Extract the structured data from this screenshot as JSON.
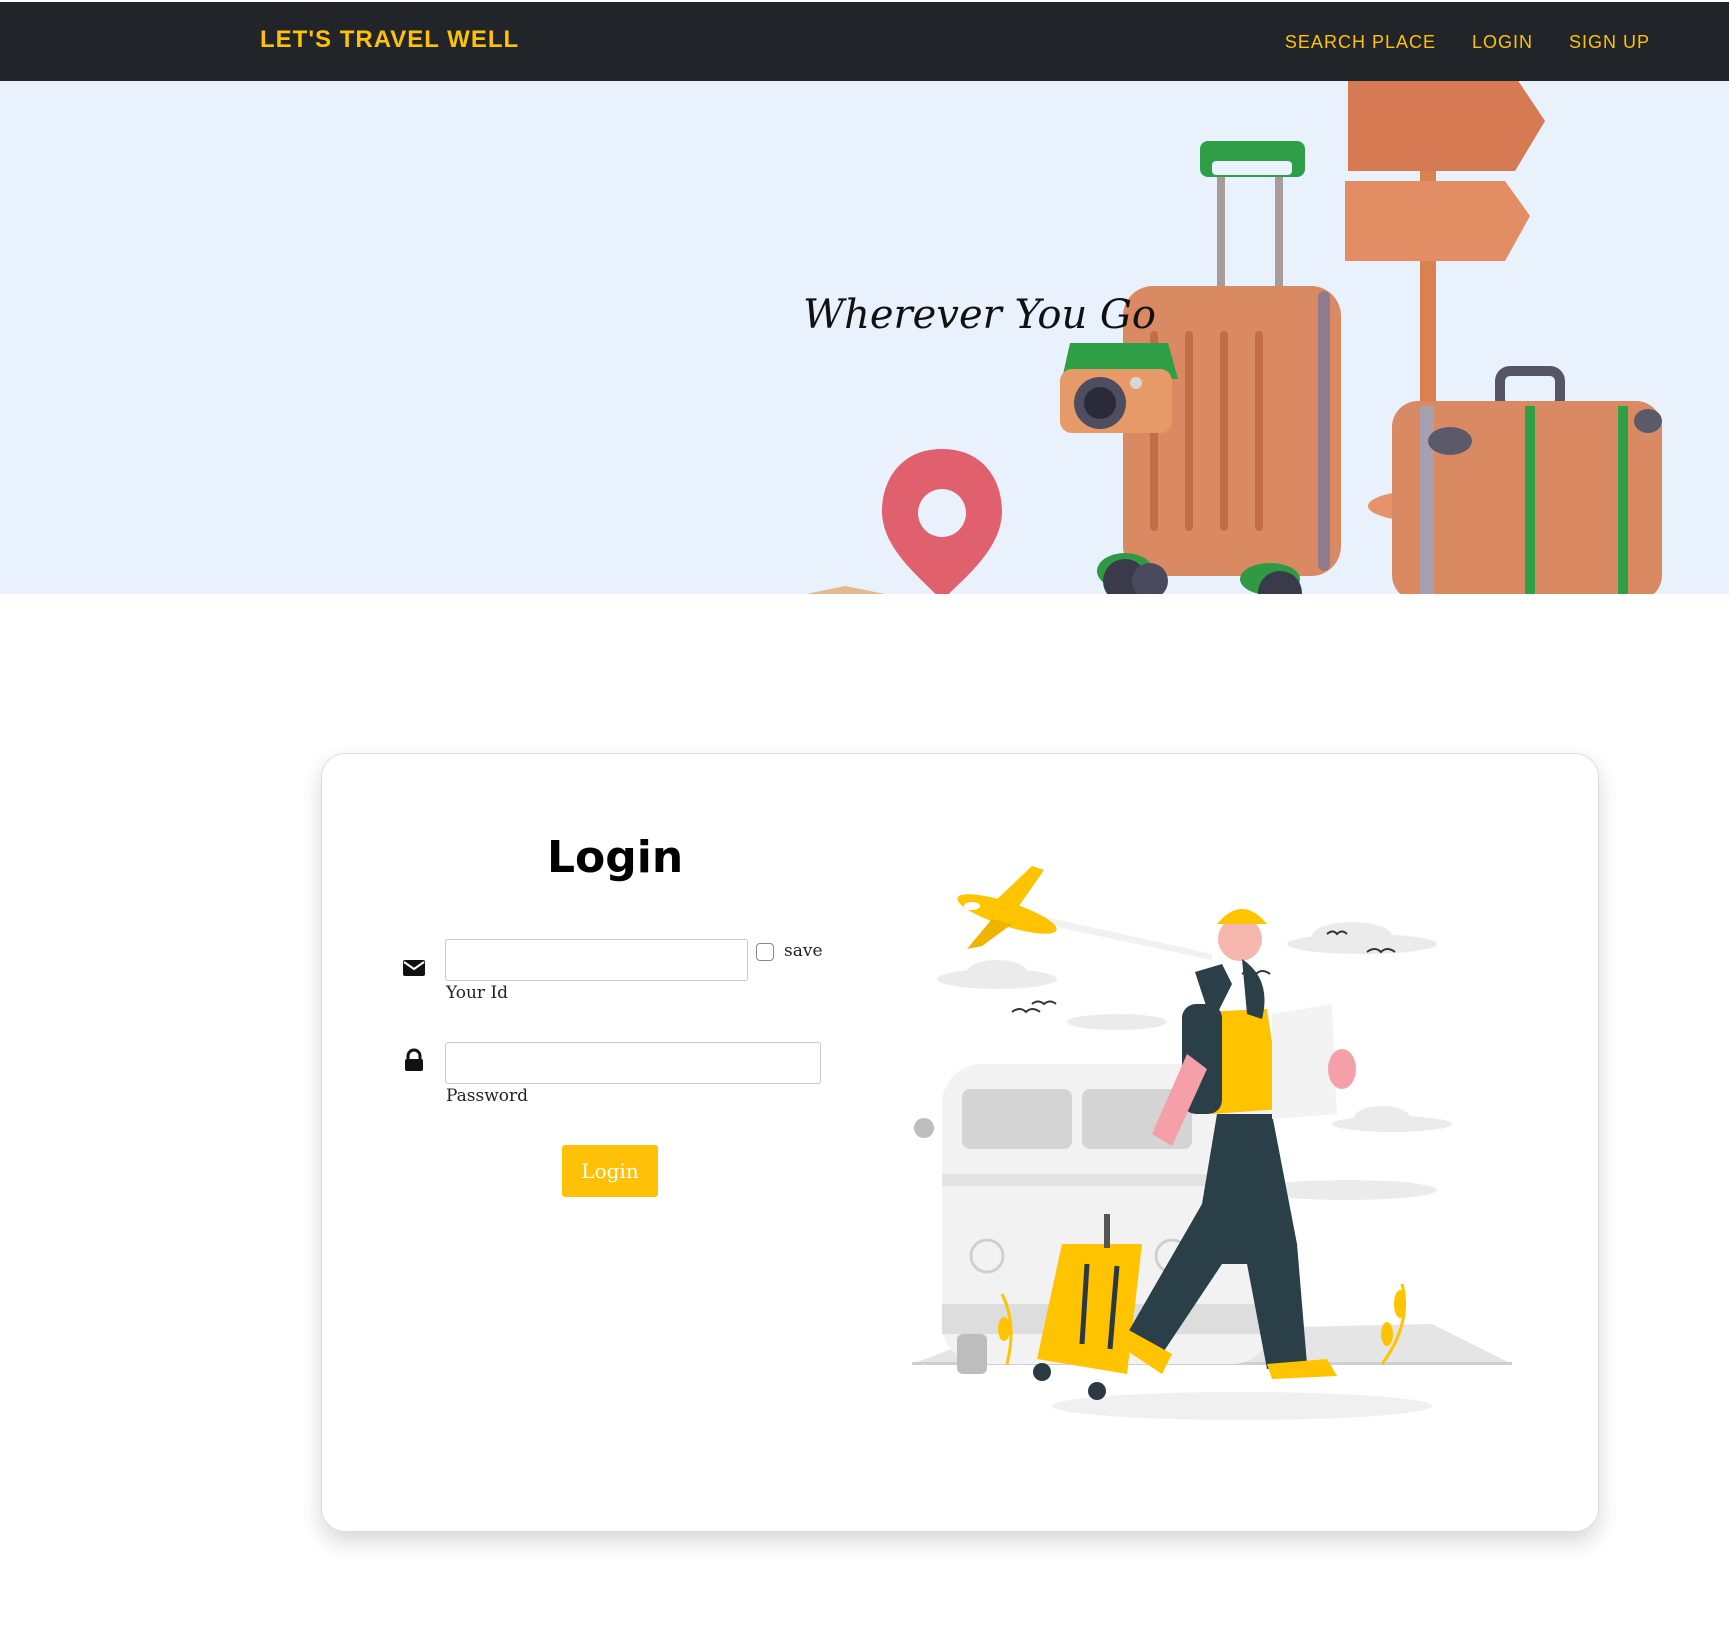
{
  "navbar": {
    "brand": "LET'S TRAVEL WELL",
    "links": [
      "SEARCH PLACE",
      "LOGIN",
      "SIGN UP"
    ]
  },
  "hero": {
    "tagline": "Wherever You Go"
  },
  "login": {
    "title": "Login",
    "id_label": "Your Id",
    "save_label": "save",
    "password_label": "Password",
    "button_label": "Login"
  },
  "colors": {
    "navbar_bg": "#212529",
    "accent": "#ffc107",
    "hero_bg": "#e8f1fc"
  }
}
